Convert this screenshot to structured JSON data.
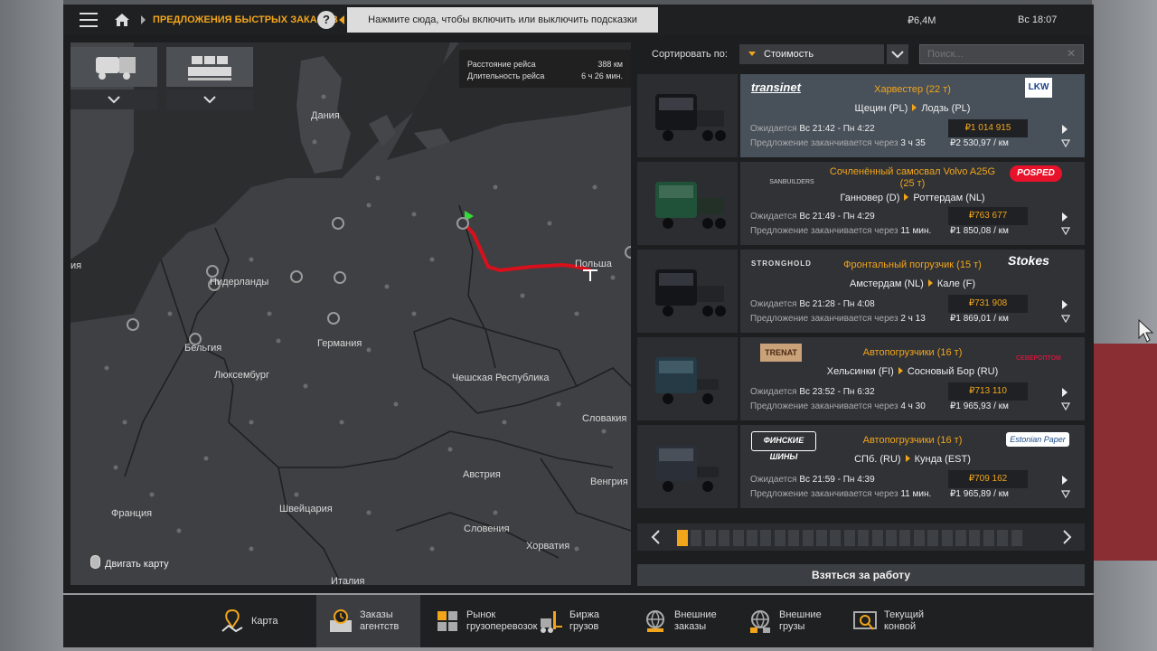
{
  "topbar": {
    "breadcrumb": "ПРЕДЛОЖЕНИЯ БЫСТРЫХ ЗАКАЗОВ",
    "help_label": "?",
    "hint": "Нажмите сюда, чтобы включить или выключить подсказки",
    "money": "₽6,4M",
    "clock": "Вс 18:07"
  },
  "route_info": {
    "distance_label": "Расстояние рейса",
    "distance": "388 км",
    "duration_label": "Длительность рейса",
    "duration": "6 ч 26 мин."
  },
  "map_labels": {
    "denmark": "Дания",
    "netherlands": "Нидерланды",
    "belgium": "Бельгия",
    "luxembourg": "Люксембург",
    "germany": "Германия",
    "poland": "Польша",
    "czech": "Чешская Республика",
    "slovakia": "Словакия",
    "austria": "Австрия",
    "hungary": "Венгрия",
    "switzerland": "Швейцария",
    "france": "Франция",
    "slovenia": "Словения",
    "croatia": "Хорватия",
    "italy": "Италия",
    "edge_fragment": "ия"
  },
  "move_map": "Двигать карту",
  "sort": {
    "label": "Сортировать по:",
    "value": "Стоимость"
  },
  "search": {
    "placeholder": "Поиск..."
  },
  "jobs": [
    {
      "logo_left": "transinet",
      "cargo": "Харвестер (22 т)",
      "from": "Щецин (PL)",
      "to": "Лодзь (PL)",
      "exp_label": "Ожидается",
      "exp": "Вс 21:42 - Пн 4:22",
      "offer_label": "Предложение заканчивается через",
      "offer": "3 ч 35",
      "price": "₽1 014 915",
      "per_km": "₽2 530,97 / км",
      "logo_right": "LKW"
    },
    {
      "logo_left": "SANBUILDERS",
      "cargo": "Сочленённый самосвал Volvo A25G",
      "cargo2": "(25 т)",
      "from": "Ганновер (D)",
      "to": "Роттердам (NL)",
      "exp_label": "Ожидается",
      "exp": "Вс 21:49 - Пн 4:29",
      "offer_label": "Предложение заканчивается через",
      "offer": "11 мин.",
      "price": "₽763 677",
      "per_km": "₽1 850,08 / км",
      "logo_right": "POSPED"
    },
    {
      "logo_left": "STRONGHOLD",
      "cargo": "Фронтальный погрузчик (15 т)",
      "from": "Амстердам (NL)",
      "to": "Кале (F)",
      "exp_label": "Ожидается",
      "exp": "Вс 21:28 - Пн 4:08",
      "offer_label": "Предложение заканчивается через",
      "offer": "2 ч 13",
      "price": "₽731 908",
      "per_km": "₽1 869,01 / км",
      "logo_right": "Stokes"
    },
    {
      "logo_left": "TRENAT",
      "cargo": "Автопогрузчики (16 т)",
      "from": "Хельсинки (FI)",
      "to": "Сосновый Бор (RU)",
      "exp_label": "Ожидается",
      "exp": "Вс 23:52 - Пн 6:32",
      "offer_label": "Предложение заканчивается через",
      "offer": "4 ч 30",
      "price": "₽713 110",
      "per_km": "₽1 965,93 / км",
      "logo_right": "СЕВЕРОПТОМ"
    },
    {
      "logo_left": "ФИНСКИЕ ШИНЫ",
      "cargo": "Автопогрузчики (16 т)",
      "from": "СПб. (RU)",
      "to": "Кунда (EST)",
      "exp_label": "Ожидается",
      "exp": "Вс 21:59 - Пн 4:39",
      "offer_label": "Предложение заканчивается через",
      "offer": "11 мин.",
      "price": "₽709 162",
      "per_km": "₽1 965,89 / км",
      "logo_right": "Estonian Paper"
    }
  ],
  "pager": {
    "pages": 25,
    "current": 1
  },
  "take_job": "Взяться за работу",
  "tabs": [
    {
      "label": "Карта",
      "icon": "map-marker-icon"
    },
    {
      "label": "Заказы агентств",
      "icon": "clock-icon"
    },
    {
      "label": "Рынок грузоперевозок",
      "icon": "grid-boxes-icon"
    },
    {
      "label": "Биржа грузов",
      "icon": "forklift-icon"
    },
    {
      "label": "Внешние заказы",
      "icon": "globe-icon"
    },
    {
      "label": "Внешние грузы",
      "icon": "globe-cargo-icon"
    },
    {
      "label": "Текущий конвой",
      "icon": "convoy-icon"
    }
  ],
  "colors": {
    "accent": "#f2a51a",
    "route": "#d8101c",
    "panel": "#1d1e20"
  }
}
